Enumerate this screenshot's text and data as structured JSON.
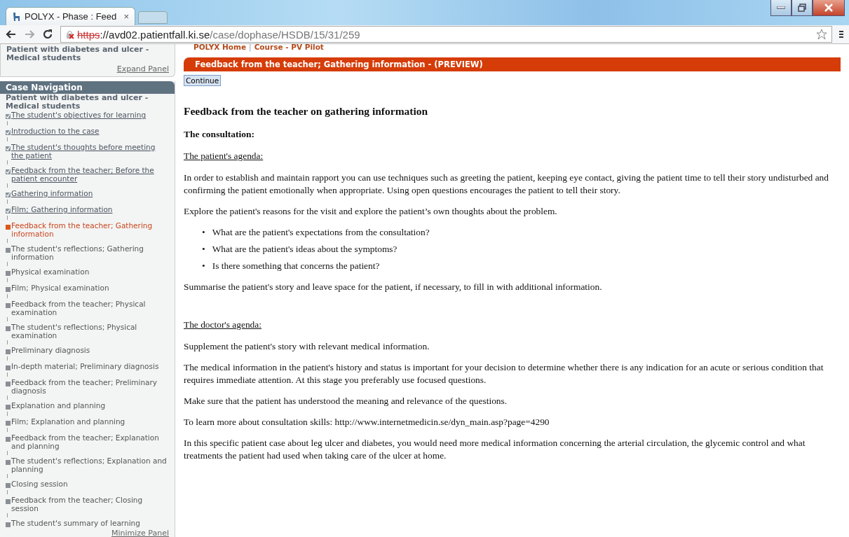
{
  "browser": {
    "tab_title": "POLYX - Phase : Feed",
    "tab_close": "×",
    "url_scheme": "https",
    "url_host": "://avd02.patientfall.ki.se",
    "url_path": "/case/dophase/HSDB/15/31/259"
  },
  "sidebar": {
    "case_title": "Patient with diabetes and ulcer - Medical students",
    "expand_link": "Expand Panel",
    "nav_heading": "Case Navigation",
    "nav_case_title": "Patient with diabetes and ulcer - Medical students",
    "minimize_link": "Minimize Panel",
    "items": [
      {
        "label": "The student's objectives for learning",
        "checked": true,
        "selected": false
      },
      {
        "label": "Introduction to the case",
        "checked": true,
        "selected": false
      },
      {
        "label": "The student's thoughts before meeting the patient",
        "checked": true,
        "selected": false
      },
      {
        "label": "Feedback from the teacher; Before the patient encounter",
        "checked": true,
        "selected": false
      },
      {
        "label": "Gathering information",
        "checked": true,
        "selected": false
      },
      {
        "label": "Film; Gathering information",
        "checked": true,
        "selected": false
      },
      {
        "label": "Feedback from the teacher; Gathering information",
        "checked": false,
        "selected": true
      },
      {
        "label": "The student's reflections; Gathering information",
        "checked": false,
        "selected": false
      },
      {
        "label": "Physical examination",
        "checked": false,
        "selected": false
      },
      {
        "label": "Film; Physical examination",
        "checked": false,
        "selected": false
      },
      {
        "label": "Feedback from the teacher; Physical examination",
        "checked": false,
        "selected": false
      },
      {
        "label": "The student's reflections; Physical examination",
        "checked": false,
        "selected": false
      },
      {
        "label": "Preliminary diagnosis",
        "checked": false,
        "selected": false
      },
      {
        "label": "In-depth material; Preliminary diagnosis",
        "checked": false,
        "selected": false
      },
      {
        "label": "Feedback from the teacher; Preliminary diagnosis",
        "checked": false,
        "selected": false
      },
      {
        "label": "Explanation and planning",
        "checked": false,
        "selected": false
      },
      {
        "label": "Film; Explanation and planning",
        "checked": false,
        "selected": false
      },
      {
        "label": "Feedback from the teacher; Explanation and planning",
        "checked": false,
        "selected": false
      },
      {
        "label": "The student's reflections; Explanation and planning",
        "checked": false,
        "selected": false
      },
      {
        "label": "Closing session",
        "checked": false,
        "selected": false
      },
      {
        "label": "Feedback from the teacher; Closing session",
        "checked": false,
        "selected": false
      },
      {
        "label": "The student's summary of learning",
        "checked": false,
        "selected": false
      }
    ]
  },
  "main": {
    "top_links": [
      "POLYX Home",
      "Course - PV Pilot"
    ],
    "top_separator": "|",
    "phase_bar": "Feedback from the teacher; Gathering information - (PREVIEW)",
    "continue_button": "Continue",
    "heading": "Feedback from the teacher on gathering information",
    "blocks": [
      {
        "kind": "subheading",
        "text": "The consultation:"
      },
      {
        "kind": "label",
        "text": "The patient's agenda:"
      },
      {
        "kind": "paragraph",
        "text": "In order to establish and maintain rapport you can use techniques such as greeting the patient, keeping eye contact, giving the patient time to tell their story undisturbed and confirming the patient emotionally when appropriate. Using open questions encourages the patient to tell their story."
      },
      {
        "kind": "paragraph",
        "text": "Explore the patient's reasons for the visit and explore the patient’s own thoughts about the problem."
      },
      {
        "kind": "list",
        "bullet": "•",
        "items": [
          "What are the patient's expectations from the consultation?",
          "What are the patient's ideas about the symptoms?",
          "Is there something that concerns the patient?"
        ]
      },
      {
        "kind": "paragraph",
        "text": "Summarise the patient's story and leave space for the patient, if necessary, to fill in with additional information."
      },
      {
        "kind": "spacer"
      },
      {
        "kind": "label",
        "text": "The doctor's agenda:"
      },
      {
        "kind": "paragraph",
        "text": "Supplement the patient's story with relevant medical information."
      },
      {
        "kind": "paragraph",
        "text": "The medical information in the patient's history and status is important for your decision to determine whether there is any indication for an acute or serious condition that requires immediate attention. At this stage you preferably use focused questions."
      },
      {
        "kind": "paragraph",
        "text": "Make sure that the patient has understood the meaning and relevance of the questions."
      },
      {
        "kind": "paragraph",
        "text": "To learn more about consultation skills: http://www.internetmedicin.se/dyn_main.asp?page=4290"
      },
      {
        "kind": "paragraph",
        "text": "In this specific patient case about leg ulcer and diabetes, you would need more medical information concerning the arterial circulation, the glycemic control and what treatments the patient had used when taking care of the ulcer at home."
      }
    ]
  }
}
